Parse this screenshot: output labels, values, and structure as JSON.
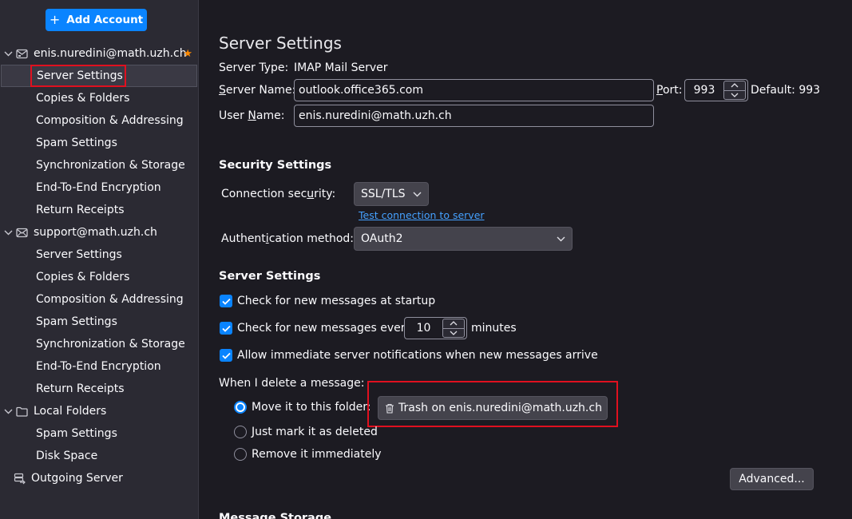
{
  "sidebar": {
    "add_account": "Add Account",
    "accounts": [
      {
        "name": "enis.nuredini@math.uzh.ch",
        "icon": "mail-account-icon",
        "default": true,
        "items": [
          "Server Settings",
          "Copies & Folders",
          "Composition & Addressing",
          "Spam Settings",
          "Synchronization & Storage",
          "End-To-End Encryption",
          "Return Receipts"
        ]
      },
      {
        "name": "support@math.uzh.ch",
        "icon": "mail-account-icon",
        "items": [
          "Server Settings",
          "Copies & Folders",
          "Composition & Addressing",
          "Spam Settings",
          "Synchronization & Storage",
          "End-To-End Encryption",
          "Return Receipts"
        ]
      },
      {
        "name": "Local Folders",
        "icon": "folder-icon",
        "items": [
          "Spam Settings",
          "Disk Space"
        ]
      }
    ],
    "outgoing": "Outgoing Server",
    "selected": "Server Settings"
  },
  "main": {
    "title": "Server Settings",
    "server_type_label": "Server Type:",
    "server_type_value": "IMAP Mail Server",
    "server_name_label": "Server Name:",
    "server_name_value": "outlook.office365.com",
    "port_label": "Port:",
    "port_value": "993",
    "default_port": "Default: 993",
    "user_name_label": "User Name:",
    "user_name_value": "enis.nuredini@math.uzh.ch",
    "security_title": "Security Settings",
    "connection_security_label": "Connection security:",
    "connection_security_value": "SSL/TLS",
    "test_connection": "Test connection to server",
    "auth_method_label": "Authentication method:",
    "auth_method_value": "OAuth2",
    "server_settings_title": "Server Settings",
    "check_startup": "Check for new messages at startup",
    "check_every": "Check for new messages every",
    "check_every_value": "10",
    "minutes": "minutes",
    "allow_notifications": "Allow immediate server notifications when new messages arrive",
    "delete_label": "When I delete a message:",
    "move_to_folder": "Move it to this folder:",
    "trash_folder": "Trash on enis.nuredini@math.uzh.ch",
    "mark_deleted": "Just mark it as deleted",
    "remove_immediately": "Remove it immediately",
    "advanced": "Advanced...",
    "message_storage_title": "Message Storage"
  },
  "colors": {
    "accent": "#0a84ff",
    "highlight": "#e0101f",
    "sidebar_bg": "#2b2a33",
    "main_bg": "#1c1b22"
  }
}
